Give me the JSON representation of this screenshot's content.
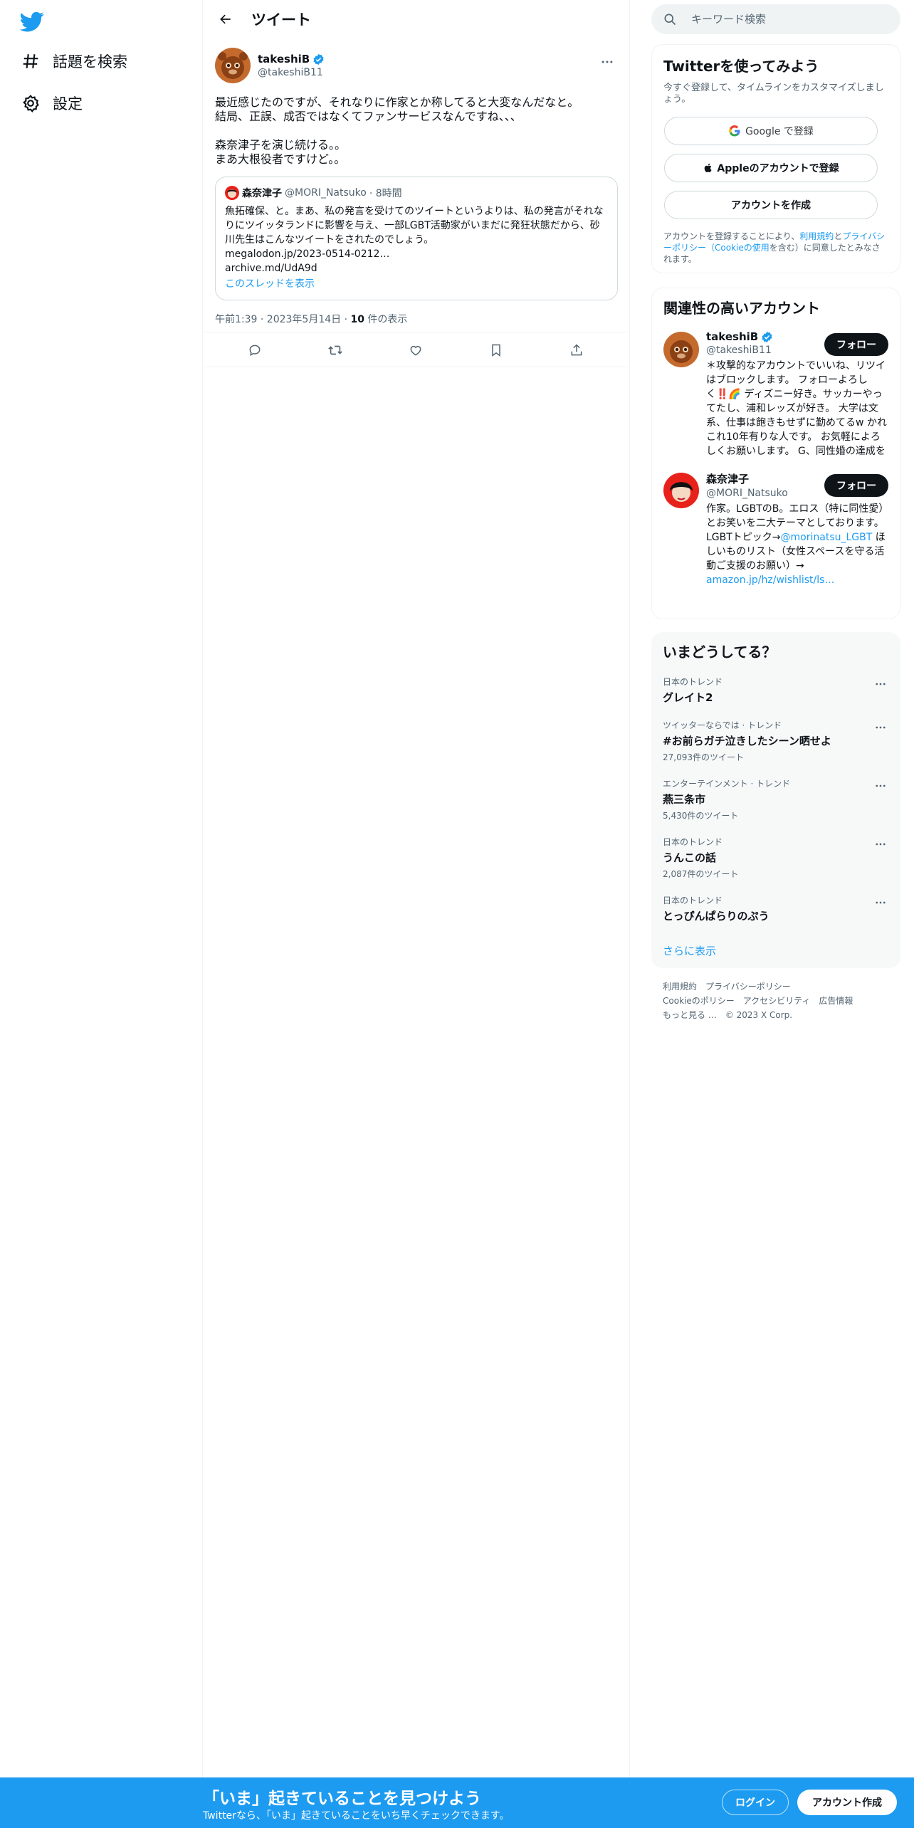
{
  "nav": {
    "explore": "話題を検索",
    "settings": "設定"
  },
  "header": {
    "title": "ツイート"
  },
  "tweet": {
    "author_name": "takeshiB",
    "author_handle": "@takeshiB11",
    "text": "最近感じたのですが、それなりに作家とか称してると大変なんだなと。\n結局、正誤、成否ではなくてファンサービスなんですね、、、\n\n森奈津子を演じ続ける。。\nまあ大根役者ですけど。。",
    "quote": {
      "name": "森奈津子",
      "handle": "@MORI_Natsuko",
      "time": "· 8時間",
      "text": "魚拓確保、と。まあ、私の発言を受けてのツイートというよりは、私の発言がそれなりにツイッタランドに影響を与え、一部LGBT活動家がいまだに発狂状態だから、砂川先生はこんなツイートをされたのでしょう。",
      "link1": "megalodon.jp/2023-0514-0212…",
      "link2": "archive.md/UdA9d",
      "show_thread": "このスレッドを表示"
    },
    "time": "午前1:39 · 2023年5月14日 · ",
    "views_count": "10",
    "views_label": " 件の表示"
  },
  "search": {
    "placeholder": "キーワード検索"
  },
  "signup": {
    "title": "Twitterを使ってみよう",
    "subtitle": "今すぐ登録して、タイムラインをカスタマイズしましょう。",
    "google": "Google で登録",
    "apple": "Appleのアカウントで登録",
    "create": "アカウントを作成",
    "terms_pre": "アカウントを登録することにより、",
    "terms_link1": "利用規約",
    "terms_mid": "と",
    "terms_link2": "プライバシーポリシー",
    "terms_link3": "（Cookieの使用",
    "terms_post": "を含む）に同意したとみなされます。"
  },
  "relevant": {
    "title": "関連性の高いアカウント",
    "people": [
      {
        "name": "takeshiB",
        "handle": "@takeshiB11",
        "follow": "フォロー",
        "bio": "＊攻撃的なアカウントでいいね、リツイはブロックします。 フォローよろしく‼️🌈 ディズニー好き。サッカーやってたし、浦和レッズが好き。 大学は文系、仕事は飽きもせずに勤めてるw かれこれ10年有りな人です。 お気軽によろしくお願いします。 G、同性婚の達成を"
      },
      {
        "name": "森奈津子",
        "handle": "@MORI_Natsuko",
        "follow": "フォロー",
        "bio": "作家。LGBTのB。エロス（特に同性愛）とお笑いを二大テーマとしております。LGBTトピック→",
        "bio_link1": "@morinatsu_LGBT",
        "bio_mid": " ほしいものリスト（女性スペースを守る活動ご支援のお願い）→ ",
        "bio_link2": "amazon.jp/hz/wishlist/ls…"
      }
    ]
  },
  "trends": {
    "title": "いまどうしてる？",
    "items": [
      {
        "context": "日本のトレンド",
        "name": "グレイト2",
        "count": ""
      },
      {
        "context": "ツイッターならでは · トレンド",
        "name": "#お前らガチ泣きしたシーン晒せよ",
        "count": "27,093件のツイート"
      },
      {
        "context": "エンターテインメント · トレンド",
        "name": "燕三条市",
        "count": "5,430件のツイート"
      },
      {
        "context": "日本のトレンド",
        "name": "うんこの話",
        "count": "2,087件のツイート"
      },
      {
        "context": "日本のトレンド",
        "name": "とっぴんぱらりのぷう",
        "count": ""
      }
    ],
    "show_more": "さらに表示"
  },
  "footer": {
    "terms": "利用規約",
    "privacy": "プライバシーポリシー",
    "cookie": "Cookieのポリシー",
    "accessibility": "アクセシビリティ",
    "ads": "広告情報",
    "more": "もっと見る …",
    "copyright": "© 2023 X Corp."
  },
  "bottom_bar": {
    "title": "「いま」起きていることを見つけよう",
    "subtitle": "Twitterなら、「いま」起きていることをいち早くチェックできます。",
    "login": "ログイン",
    "create": "アカウント作成"
  },
  "colors": {
    "accent": "#1d9bf0",
    "text": "#0f1419",
    "muted": "#536471",
    "border": "#eff3f4"
  }
}
